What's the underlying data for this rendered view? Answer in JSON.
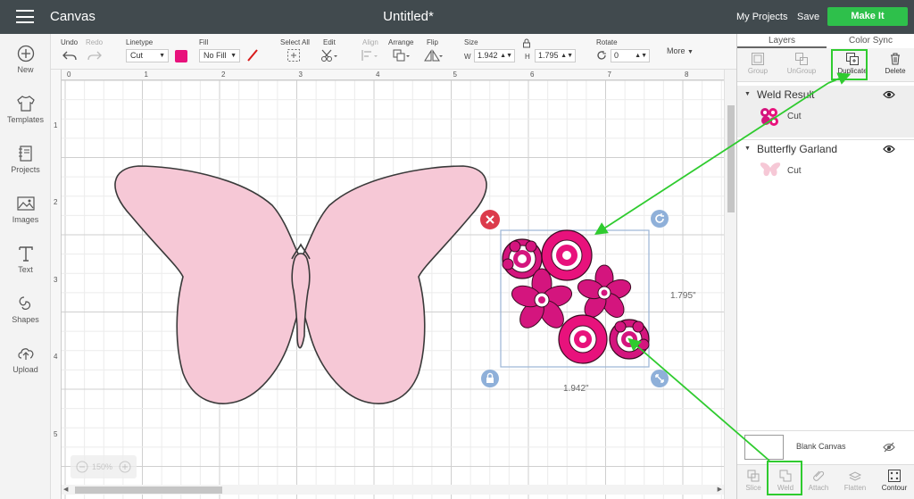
{
  "topbar": {
    "app_title": "Canvas",
    "doc_title": "Untitled*",
    "my_projects": "My Projects",
    "save": "Save",
    "make_it": "Make It"
  },
  "leftbar": {
    "items": [
      {
        "label": "New",
        "icon": "plus-circle-icon"
      },
      {
        "label": "Templates",
        "icon": "shirt-icon"
      },
      {
        "label": "Projects",
        "icon": "notebook-icon"
      },
      {
        "label": "Images",
        "icon": "image-icon"
      },
      {
        "label": "Text",
        "icon": "text-icon"
      },
      {
        "label": "Shapes",
        "icon": "shapes-icon"
      },
      {
        "label": "Upload",
        "icon": "upload-cloud-icon"
      }
    ]
  },
  "toolbar": {
    "undo": "Undo",
    "redo": "Redo",
    "linetype_label": "Linetype",
    "linetype_value": "Cut",
    "fill_label": "Fill",
    "fill_value": "No Fill",
    "select_all": "Select All",
    "edit": "Edit",
    "align": "Align",
    "arrange": "Arrange",
    "flip": "Flip",
    "size_label": "Size",
    "w_label": "W",
    "w_value": "1.942",
    "h_label": "H",
    "h_value": "1.795",
    "rotate_label": "Rotate",
    "rotate_value": "0",
    "more": "More",
    "swatch_color": "#e8127c"
  },
  "canvas": {
    "ruler_top": [
      "0",
      "1",
      "2",
      "3",
      "4",
      "5",
      "6",
      "7",
      "8"
    ],
    "ruler_left": [
      "1",
      "2",
      "3",
      "4",
      "5"
    ],
    "width_label": "1.942\"",
    "height_label": "1.795\"",
    "zoom_label": "150%",
    "butterfly_color": "#f6c8d6",
    "flower_color": "#d4157e"
  },
  "panel": {
    "tab_layers": "Layers",
    "tab_color_sync": "Color Sync",
    "actions": {
      "group": "Group",
      "ungroup": "UnGroup",
      "duplicate": "Duplicate",
      "delete": "Delete"
    },
    "groups": [
      {
        "name": "Weld Result",
        "layer": "Cut"
      },
      {
        "name": "Butterfly Garland",
        "layer": "Cut"
      }
    ],
    "blank_canvas": "Blank Canvas",
    "bottom_actions": {
      "slice": "Slice",
      "weld": "Weld",
      "attach": "Attach",
      "flatten": "Flatten",
      "contour": "Contour"
    }
  },
  "colors": {
    "topbar": "#414a4e",
    "make_it": "#2ec04b",
    "highlight": "#2fcb2f"
  }
}
